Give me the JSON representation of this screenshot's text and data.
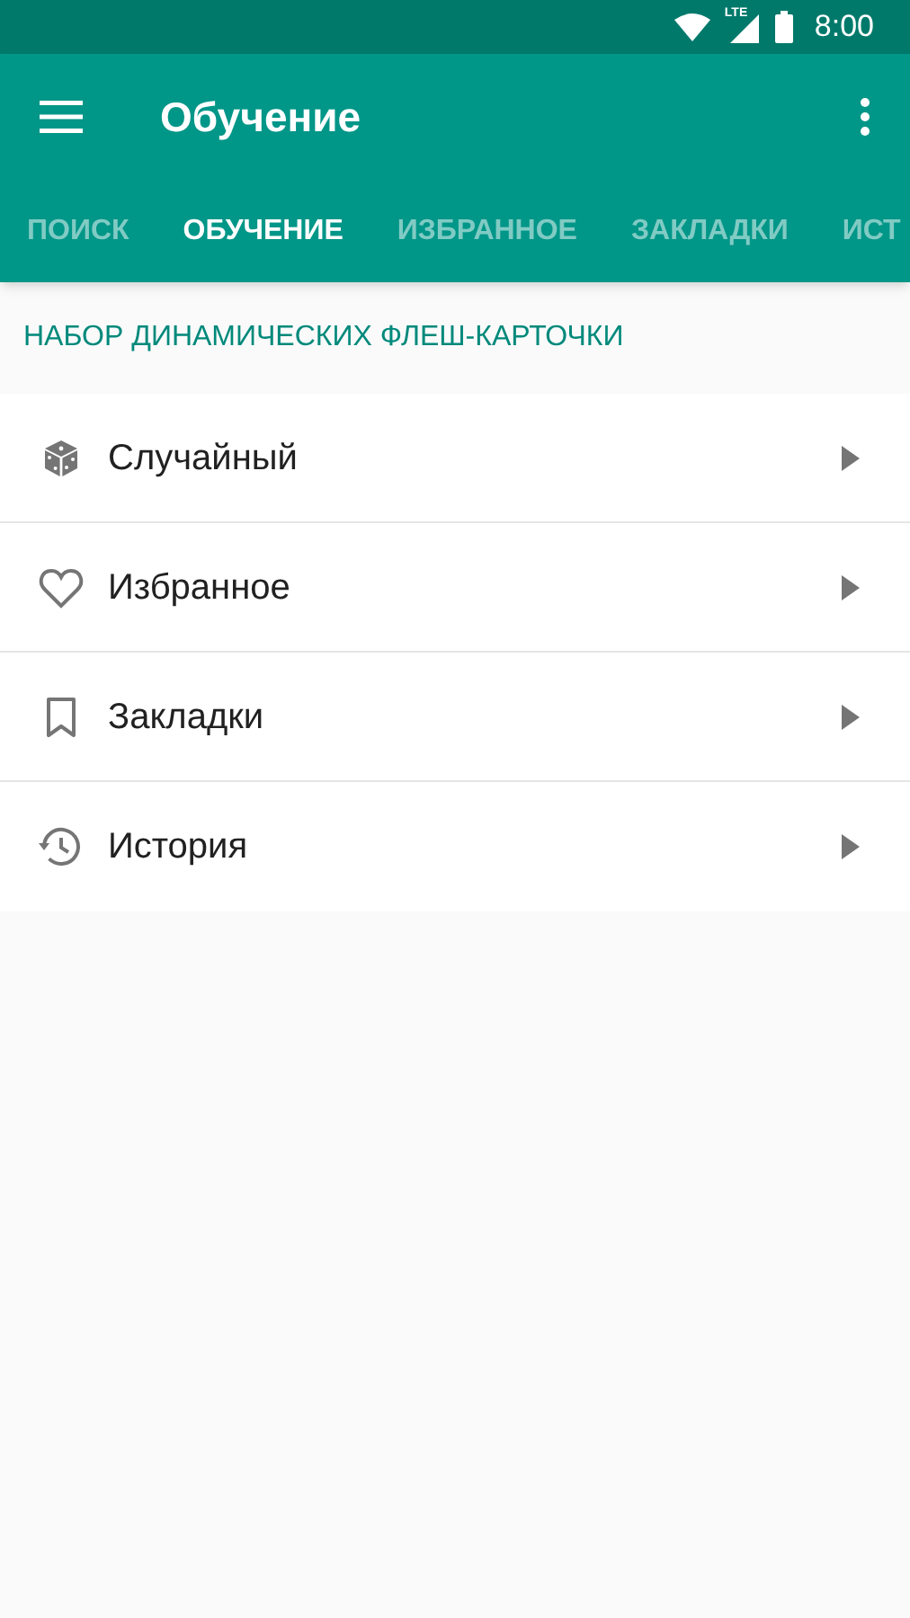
{
  "status_bar": {
    "time": "8:00",
    "network": "LTE"
  },
  "app_bar": {
    "title": "Обучение"
  },
  "tabs": [
    {
      "label": "ПОИСК",
      "selected": false
    },
    {
      "label": "ОБУЧЕНИЕ",
      "selected": true
    },
    {
      "label": "ИЗБРАННОЕ",
      "selected": false
    },
    {
      "label": "ЗАКЛАДКИ",
      "selected": false
    },
    {
      "label": "ИСТ",
      "selected": false
    }
  ],
  "section": {
    "header": "НАБОР ДИНАМИЧЕСКИХ ФЛЕШ-КАРТОЧКИ"
  },
  "items": [
    {
      "kind": "dice",
      "label": "Случайный"
    },
    {
      "kind": "heart",
      "label": "Избранное"
    },
    {
      "kind": "bookmark",
      "label": "Закладки"
    },
    {
      "kind": "history",
      "label": "История"
    }
  ]
}
